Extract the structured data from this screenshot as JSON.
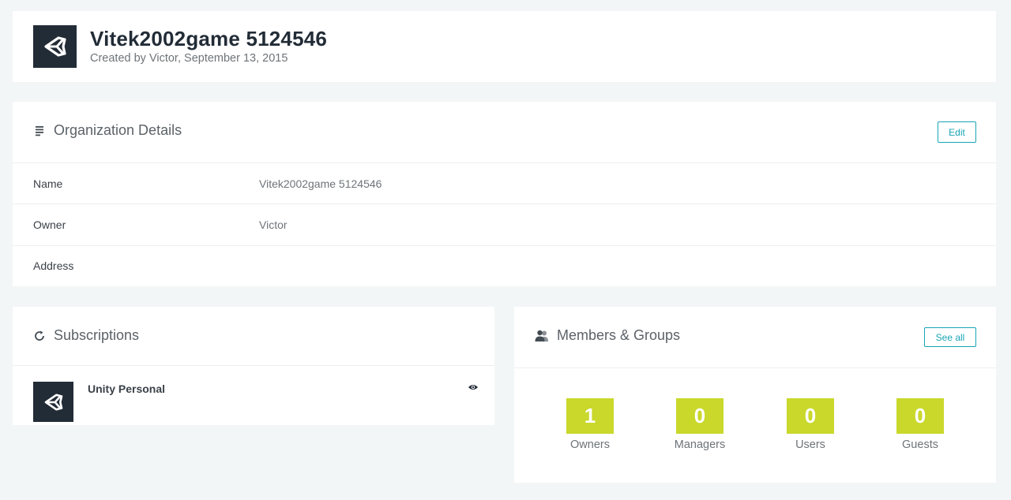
{
  "header": {
    "title": "Vitek2002game 5124546",
    "subtitle": "Created by Victor, September 13, 2015",
    "logo_icon": "unity-logo-icon"
  },
  "details": {
    "heading": "Organization Details",
    "heading_icon": "document-lines-icon",
    "edit_label": "Edit",
    "rows": [
      {
        "label": "Name",
        "value": "Vitek2002game 5124546"
      },
      {
        "label": "Owner",
        "value": "Victor"
      },
      {
        "label": "Address",
        "value": ""
      }
    ]
  },
  "subscriptions": {
    "heading": "Subscriptions",
    "heading_icon": "refresh-icon",
    "items": [
      {
        "name": "Unity Personal",
        "icon": "unity-logo-icon",
        "action_icon": "eye-icon"
      }
    ]
  },
  "members": {
    "heading": "Members & Groups",
    "heading_icon": "users-icon",
    "see_all_label": "See all",
    "stats": [
      {
        "count": "1",
        "label": "Owners"
      },
      {
        "count": "0",
        "label": "Managers"
      },
      {
        "count": "0",
        "label": "Users"
      },
      {
        "count": "0",
        "label": "Guests"
      }
    ]
  },
  "colors": {
    "background": "#f3f6f6",
    "dark": "#222c37",
    "accent": "#19a5b6",
    "stat_fill": "#c9d82b"
  }
}
